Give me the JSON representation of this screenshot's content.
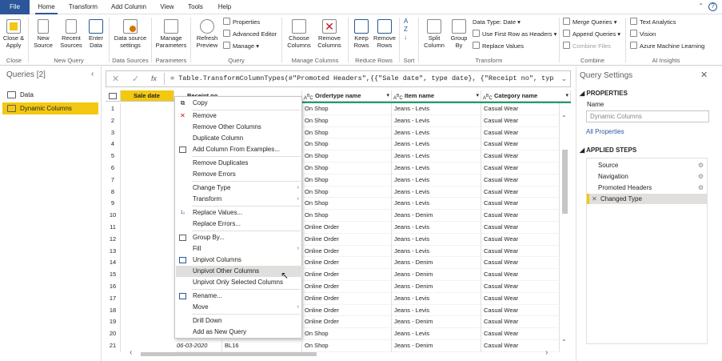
{
  "tabs": [
    "File",
    "Home",
    "Transform",
    "Add Column",
    "View",
    "Tools",
    "Help"
  ],
  "ribbon": {
    "close_apply": "Close &\nApply",
    "new_source": "New\nSource",
    "recent_sources": "Recent\nSources",
    "enter_data": "Enter\nData",
    "ds_settings": "Data source\nsettings",
    "manage_params": "Manage\nParameters",
    "refresh_preview": "Refresh\nPreview",
    "properties": "Properties",
    "advanced_editor": "Advanced Editor",
    "manage": "Manage",
    "choose_columns": "Choose\nColumns",
    "remove_columns": "Remove\nColumns",
    "keep_rows": "Keep\nRows",
    "remove_rows": "Remove\nRows",
    "sort": "",
    "split_column": "Split\nColumn",
    "group_by": "Group\nBy",
    "data_type": "Data Type: Date",
    "first_row_headers": "Use First Row as Headers",
    "replace_values": "Replace Values",
    "merge_queries": "Merge Queries",
    "append_queries": "Append Queries",
    "combine_files": "Combine Files",
    "text_analytics": "Text Analytics",
    "vision": "Vision",
    "azure_ml": "Azure Machine Learning",
    "groups": [
      "Close",
      "New Query",
      "Data Sources",
      "Parameters",
      "Query",
      "Manage Columns",
      "Reduce Rows",
      "Sort",
      "Transform",
      "Combine",
      "AI Insights"
    ]
  },
  "queries": {
    "title": "Queries [2]",
    "items": [
      "Data",
      "Dynamic Columns"
    ]
  },
  "formula": {
    "fx": "fx",
    "text": "= Table.TransformColumnTypes(#\"Promoted Headers\",{{\"Sale date\", type date}, {\"Receipt no\", type text}, {"
  },
  "grid": {
    "headers": [
      "Sale date",
      "Receipt no",
      "Ordertype name",
      "Item name",
      "Category name"
    ],
    "rows": [
      [
        "On Shop",
        "Jeans - Levis",
        "Casual Wear"
      ],
      [
        "On Shop",
        "Jeans - Levis",
        "Casual Wear"
      ],
      [
        "On Shop",
        "Jeans - Levis",
        "Casual Wear"
      ],
      [
        "On Shop",
        "Jeans - Levis",
        "Casual Wear"
      ],
      [
        "On Shop",
        "Jeans - Levis",
        "Casual Wear"
      ],
      [
        "On Shop",
        "Jeans - Levis",
        "Casual Wear"
      ],
      [
        "On Shop",
        "Jeans - Levis",
        "Casual Wear"
      ],
      [
        "On Shop",
        "Jeans - Levis",
        "Casual Wear"
      ],
      [
        "On Shop",
        "Jeans - Levis",
        "Casual Wear"
      ],
      [
        "On Shop",
        "Jeans - Denim",
        "Casual Wear"
      ],
      [
        "Online Order",
        "Jeans - Levis",
        "Casual Wear"
      ],
      [
        "Online Order",
        "Jeans - Levis",
        "Casual Wear"
      ],
      [
        "Online Order",
        "Jeans - Levis",
        "Casual Wear"
      ],
      [
        "Online Order",
        "Jeans - Denim",
        "Casual Wear"
      ],
      [
        "Online Order",
        "Jeans - Denim",
        "Casual Wear"
      ],
      [
        "Online Order",
        "Jeans - Denim",
        "Casual Wear"
      ],
      [
        "Online Order",
        "Jeans - Levis",
        "Casual Wear"
      ],
      [
        "Online Order",
        "Jeans - Levis",
        "Casual Wear"
      ],
      [
        "Online Order",
        "Jeans - Denim",
        "Casual Wear"
      ],
      [
        "On Shop",
        "Jeans - Levis",
        "Casual Wear"
      ],
      [
        "On Shop",
        "Jeans - Denim",
        "Casual Wear"
      ]
    ],
    "last_row_date": "06-03-2020",
    "last_row_receipt": "BL16"
  },
  "menu": [
    "Copy",
    "Remove",
    "Remove Other Columns",
    "Duplicate Column",
    "Add Column From Examples...",
    "Remove Duplicates",
    "Remove Errors",
    "Change Type",
    "Transform",
    "Replace Values...",
    "Replace Errors...",
    "Group By...",
    "Fill",
    "Unpivot Columns",
    "Unpivot Other Columns",
    "Unpivot Only Selected Columns",
    "Rename...",
    "Move",
    "Drill Down",
    "Add as New Query"
  ],
  "settings": {
    "title": "Query Settings",
    "properties": "PROPERTIES",
    "name_label": "Name",
    "name_value": "Dynamic Columns",
    "all_properties": "All Properties",
    "applied_steps": "APPLIED STEPS",
    "steps": [
      "Source",
      "Navigation",
      "Promoted Headers",
      "Changed Type"
    ]
  },
  "colors": {
    "accent": "#2b579a",
    "selected": "#f2c811",
    "green": "#1f9e6e"
  }
}
